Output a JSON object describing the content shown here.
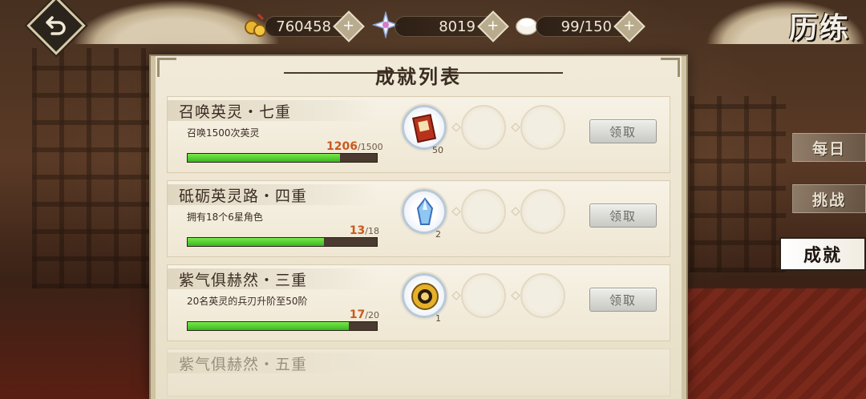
{
  "header": {
    "title": "历练",
    "resources": [
      {
        "name": "gold",
        "icon": "gold-coins-icon",
        "value": "760458"
      },
      {
        "name": "spirit-crystal",
        "icon": "star-crystal-icon",
        "value": "8019"
      },
      {
        "name": "stamina",
        "icon": "rice-cake-icon",
        "value": "99/150"
      }
    ],
    "plus_label": "+"
  },
  "panel": {
    "title": "成就列表",
    "claim_label": "领取",
    "achievements": [
      {
        "name": "召唤英灵・七重",
        "desc": "召唤1500次英灵",
        "current": "1206",
        "total": "/1500",
        "progress": 0.804,
        "reward_icon": "summon-scroll-icon",
        "reward_count": "50"
      },
      {
        "name": "砥砺英灵路・四重",
        "desc": "拥有18个6星角色",
        "current": "13",
        "total": "/18",
        "progress": 0.722,
        "reward_icon": "blue-crystal-icon",
        "reward_count": "2"
      },
      {
        "name": "紫气俱赫然・三重",
        "desc": "20名英灵的兵刃升阶至50阶",
        "current": "17",
        "total": "/20",
        "progress": 0.85,
        "reward_icon": "gold-medal-icon",
        "reward_count": "1"
      },
      {
        "name": "紫气俱赫然・五重"
      }
    ]
  },
  "tabs": [
    {
      "label": "每日",
      "active": false
    },
    {
      "label": "挑战",
      "active": false
    },
    {
      "label": "成就",
      "active": true
    }
  ],
  "colors": {
    "progress_green": "#5cd235",
    "progress_current": "#c85a1e",
    "panel_paper": "#f1ead9"
  }
}
